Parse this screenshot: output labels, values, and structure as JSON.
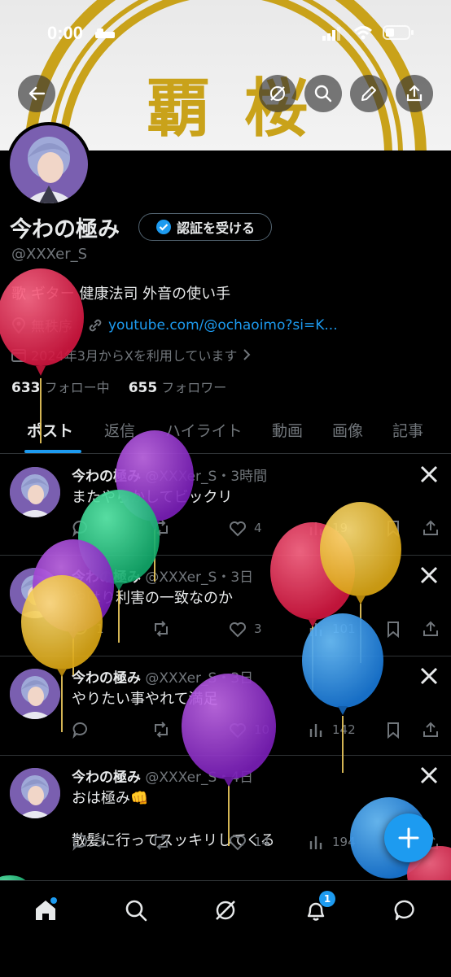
{
  "status": {
    "time": "0:00"
  },
  "banner": {
    "chars": [
      "覇",
      "桜"
    ]
  },
  "profile": {
    "name": "今わの極み",
    "verify_label": "認証を受ける",
    "handle": "@XXXer_S",
    "bio": "歌 ギター 健康法司 外音の使い手",
    "location": "無秩序",
    "link": "youtube.com/@ochaoimo?si=K...",
    "joined": "2024年3月からXを利用しています",
    "following_count": "633",
    "following_label": "フォロー中",
    "followers_count": "655",
    "followers_label": "フォロワー"
  },
  "tabs": [
    "ポスト",
    "返信",
    "ハイライト",
    "動画",
    "画像",
    "記事"
  ],
  "posts": [
    {
      "name": "今わの極み",
      "meta": "@XXXer_S・3時間",
      "text": "またやらかしてビックリ",
      "replies": "",
      "reposts": "",
      "likes": "4",
      "views": "19"
    },
    {
      "name": "今わの極み",
      "meta": "@XXXer_S・3日",
      "text": "やはり利害の一致なのか",
      "replies": "1",
      "reposts": "",
      "likes": "3",
      "views": "101"
    },
    {
      "name": "今わの極み",
      "meta": "@XXXer_S・3日",
      "text": "やりたい事やれて満足",
      "replies": "",
      "reposts": "",
      "likes": "10",
      "views": "142"
    },
    {
      "name": "今わの極み",
      "meta": "@XXXer_S・4日",
      "text": "おは極み👊\n\n散髪に行ってスッキリしてくる",
      "replies": "3",
      "reposts": "",
      "likes": "14",
      "views": "194"
    }
  ],
  "nav": {
    "notification_badge": "1"
  },
  "colors": {
    "accent": "#1d9bf0",
    "text": "#e7e9ea",
    "muted": "#71767b",
    "divider": "#2f3336"
  }
}
